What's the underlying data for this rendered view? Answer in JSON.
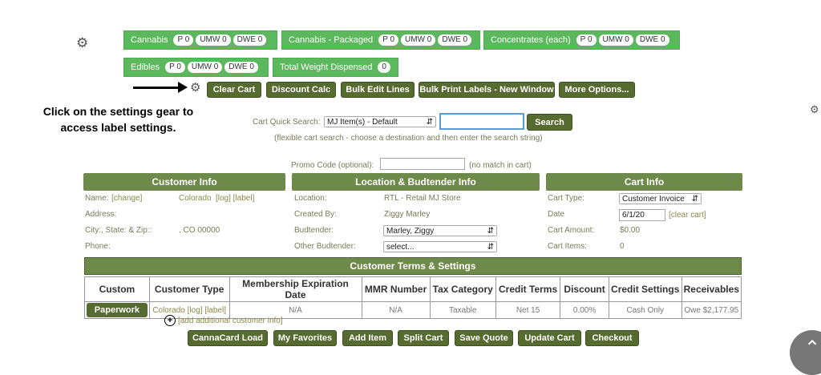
{
  "summary": {
    "cannabis": {
      "label": "Cannabis",
      "p": "P 0",
      "umw": "UMW 0",
      "dwe": "DWE 0"
    },
    "cannabis_packaged": {
      "label": "Cannabis - Packaged",
      "p": "P 0",
      "umw": "UMW 0",
      "dwe": "DWE 0"
    },
    "concentrates": {
      "label": "Concentrates (each)",
      "p": "P 0",
      "umw": "UMW 0",
      "dwe": "DWE 0"
    },
    "edibles": {
      "label": "Edibles",
      "p": "P 0",
      "umw": "UMW 0",
      "dwe": "DWE 0"
    },
    "total_weight": {
      "label": "Total Weight Dispensed",
      "value": "0"
    }
  },
  "toolbar": {
    "clear_cart": "Clear Cart",
    "discount_calc": "Discount Calc",
    "bulk_edit": "Bulk Edit Lines",
    "bulk_print": "Bulk Print Labels - New Window",
    "more_options": "More Options..."
  },
  "annotation": {
    "text": "Click on the settings gear to access label settings."
  },
  "search": {
    "label": "Cart Quick Search:",
    "destination": "MJ Item(s) - Default",
    "button": "Search",
    "hint": "(flexible cart search - choose a destination and then enter the search string)"
  },
  "promo": {
    "label": "Promo Code (optional):",
    "status": "(no match in cart)"
  },
  "customer_info": {
    "title": "Customer Info",
    "name_label": "Name:",
    "name_change": "[change]",
    "name_value": "Colorado",
    "name_links": "[log] [label]",
    "address_label": "Address:",
    "city_label": "City:, State: & Zip::",
    "city_value": ", CO 00000",
    "phone_label": "Phone:"
  },
  "location_info": {
    "title": "Location & Budtender Info",
    "location_label": "Location:",
    "location_value": "RTL - Retail MJ Store",
    "created_label": "Created By:",
    "created_value": "Ziggy Marley",
    "budtender_label": "Budtender:",
    "budtender_value": "Marley, Ziggy",
    "other_label": "Other Budtender:",
    "other_value": "select..."
  },
  "cart_info": {
    "title": "Cart Info",
    "type_label": "Cart Type:",
    "type_value": "Customer Invoice",
    "date_label": "Date",
    "date_value": "6/1/20",
    "clear_link": "[clear cart]",
    "amount_label": "Cart Amount:",
    "amount_value": "$0.00",
    "items_label": "Cart Items:",
    "items_value": "0"
  },
  "terms": {
    "title": "Customer Terms & Settings",
    "headers": [
      "Custom",
      "Customer Type",
      "Membership Expiration Date",
      "MMR Number",
      "Tax Category",
      "Credit Terms",
      "Discount",
      "Credit Settings",
      "Receivables"
    ],
    "row": {
      "paperwork": "Paperwork",
      "customer_type": "Colorado [log] [label]",
      "membership": "N/A",
      "mmr": "N/A",
      "tax": "Taxable",
      "credit_terms": "Net 15",
      "discount": "0.00%",
      "credit_settings": "Cash Only",
      "receivables": "Owe $2,177.95"
    }
  },
  "add_info": "[add additional customer info]",
  "bottom_buttons": {
    "cannacard": "CannaCard Load",
    "favorites": "My Favorites",
    "add_item": "Add Item",
    "split_cart": "Split Cart",
    "save_quote": "Save Quote",
    "update_cart": "Update Cart",
    "checkout": "Checkout"
  },
  "colors": {
    "green_box": "#5cb85c",
    "dark_olive_button": "#556b2f",
    "section_header": "#6d8a4b"
  }
}
